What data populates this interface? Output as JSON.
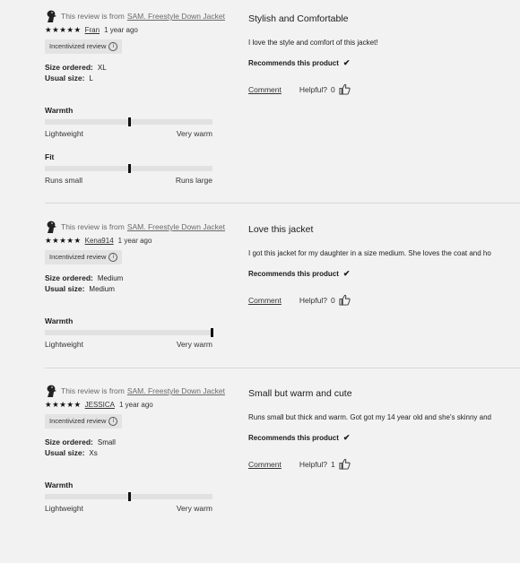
{
  "reviews": [
    {
      "from_prefix": "This review is from",
      "product_link": "SAM. Freestyle Down Jacket",
      "stars": "★★★★★",
      "author": "Fran",
      "age": "1 year ago",
      "badge": "Incentivized review",
      "size_ordered_label": "Size ordered:",
      "size_ordered": "XL",
      "usual_size_label": "Usual size:",
      "usual_size": "L",
      "metrics": [
        {
          "title": "Warmth",
          "min_label": "Lightweight",
          "max_label": "Very warm",
          "value": 0.5
        },
        {
          "title": "Fit",
          "min_label": "Runs small",
          "max_label": "Runs large",
          "value": 0.5
        }
      ],
      "title": "Stylish and Comfortable",
      "body": "I love the style and comfort of this jacket!",
      "recommends": "Recommends this product",
      "comment_label": "Comment",
      "helpful_label": "Helpful?",
      "helpful_count": "0"
    },
    {
      "from_prefix": "This review is from",
      "product_link": "SAM. Freestyle Down Jacket",
      "stars": "★★★★★",
      "author": "Kena914",
      "age": "1 year ago",
      "badge": "Incentivized review",
      "size_ordered_label": "Size ordered:",
      "size_ordered": "Medium",
      "usual_size_label": "Usual size:",
      "usual_size": "Medium",
      "metrics": [
        {
          "title": "Warmth",
          "min_label": "Lightweight",
          "max_label": "Very warm",
          "value": 1.0
        }
      ],
      "title": "Love this jacket",
      "body": "I got this jacket for my daughter in a size medium. She loves the coat and ho",
      "recommends": "Recommends this product",
      "comment_label": "Comment",
      "helpful_label": "Helpful?",
      "helpful_count": "0"
    },
    {
      "from_prefix": "This review is from",
      "product_link": "SAM. Freestyle Down Jacket",
      "stars": "★★★★★",
      "author": "JESSICA",
      "age": "1 year ago",
      "badge": "Incentivized review",
      "size_ordered_label": "Size ordered:",
      "size_ordered": "Small",
      "usual_size_label": "Usual size:",
      "usual_size": "Xs",
      "metrics": [
        {
          "title": "Warmth",
          "min_label": "Lightweight",
          "max_label": "Very warm",
          "value": 0.5
        }
      ],
      "title": "Small but warm and cute",
      "body": "Runs small but thick and warm. Got got my 14 year old and she's skinny and",
      "recommends": "Recommends this product",
      "comment_label": "Comment",
      "helpful_label": "Helpful?",
      "helpful_count": "1"
    }
  ],
  "icons": {
    "avatar": "bird-avatar-icon",
    "check": "checkmark-icon",
    "thumb": "thumbs-up-icon",
    "info": "info-icon"
  }
}
